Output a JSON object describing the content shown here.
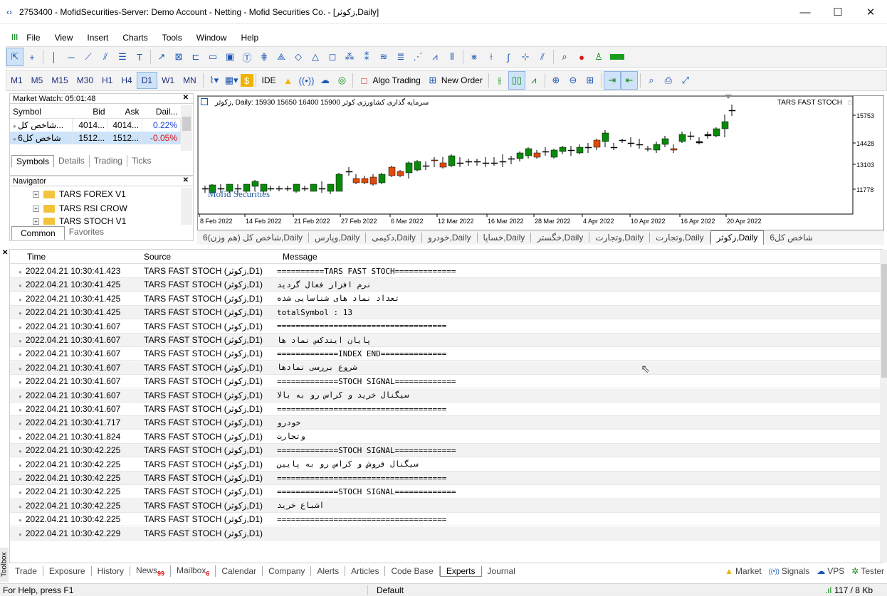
{
  "window": {
    "title": "2753400 - MofidSecurities-Server: Demo Account - Netting - Mofid Securities Co. - [زکوثر,Daily]",
    "minimize": "—",
    "maximize": "☐",
    "close": "✕"
  },
  "menu": [
    "File",
    "View",
    "Insert",
    "Charts",
    "Tools",
    "Window",
    "Help"
  ],
  "timeframes": [
    "M1",
    "M5",
    "M15",
    "M30",
    "H1",
    "H4",
    "D1",
    "W1",
    "MN"
  ],
  "toolbar2": {
    "ide": "IDE",
    "algo": "Algo Trading",
    "new_order": "New Order"
  },
  "market_watch": {
    "title": "Market Watch: 05:01:48",
    "columns": [
      "Symbol",
      "Bid",
      "Ask",
      "Dail..."
    ],
    "rows": [
      {
        "symbol": "شاخص کل...",
        "bid": "4014...",
        "ask": "4014...",
        "daily": "0.22%",
        "color": "#1a3fd6"
      },
      {
        "symbol": "شاخص کل6",
        "bid": "1512...",
        "ask": "1512...",
        "daily": "-0.05%",
        "color": "#d11"
      }
    ],
    "tabs": [
      "Symbols",
      "Details",
      "Trading",
      "Ticks"
    ]
  },
  "navigator": {
    "title": "Navigator",
    "items": [
      "TARS FOREX V1",
      "TARS RSI CROW",
      "TARS STOCH V1"
    ],
    "tabs": [
      "Common",
      "Favorites"
    ]
  },
  "chart": {
    "header": "زکوثر, Daily:  15930 15650 16400 15900  سرمایه گذاری کشاورزی کوثر",
    "indicator": "TARS FAST STOCH",
    "watermark": "Mofid Securities",
    "price_labels": [
      "15753",
      "14428",
      "13103",
      "11778"
    ],
    "date_labels": [
      "8 Feb 2022",
      "14 Feb 2022",
      "21 Feb 2022",
      "27 Feb 2022",
      "6 Mar 2022",
      "12 Mar 2022",
      "16 Mar 2022",
      "28 Mar 2022",
      "4 Apr 2022",
      "10 Apr 2022",
      "16 Apr 2022",
      "20 Apr 2022"
    ],
    "up_color": "#0a8a0a",
    "down_color": "#e24a0a"
  },
  "chart_tabs": [
    "شاخص کل (هم وزن)6,Daily",
    "وپارس,Daily",
    "دکیمی,Daily",
    "خودرو,Daily",
    "خساپا,Daily",
    "خگستر,Daily",
    "وتجارت,Daily",
    "وتجارت,Daily",
    "زکوثر,Daily",
    "شاخص کل6"
  ],
  "log": {
    "columns": [
      "Time",
      "Source",
      "Message"
    ],
    "rows": [
      {
        "time": "2022.04.21 10:30:41.423",
        "source": "TARS FAST STOCH (زکوثر,D1)",
        "msg": "==========TARS FAST STOCH============="
      },
      {
        "time": "2022.04.21 10:30:41.425",
        "source": "TARS FAST STOCH (زکوثر,D1)",
        "msg": "نرم افزار فعال گردید"
      },
      {
        "time": "2022.04.21 10:30:41.425",
        "source": "TARS FAST STOCH (زکوثر,D1)",
        "msg": "تعداد نماد های شناسایی شده"
      },
      {
        "time": "2022.04.21 10:30:41.425",
        "source": "TARS FAST STOCH (زکوثر,D1)",
        "msg": "totalSymbol : 13"
      },
      {
        "time": "2022.04.21 10:30:41.607",
        "source": "TARS FAST STOCH (زکوثر,D1)",
        "msg": "===================================="
      },
      {
        "time": "2022.04.21 10:30:41.607",
        "source": "TARS FAST STOCH (زکوثر,D1)",
        "msg": "پایان ایندکس نماد ها"
      },
      {
        "time": "2022.04.21 10:30:41.607",
        "source": "TARS FAST STOCH (زکوثر,D1)",
        "msg": "=============INDEX END=============="
      },
      {
        "time": "2022.04.21 10:30:41.607",
        "source": "TARS FAST STOCH (زکوثر,D1)",
        "msg": "شروع بررسی نمادها"
      },
      {
        "time": "2022.04.21 10:30:41.607",
        "source": "TARS FAST STOCH (زکوثر,D1)",
        "msg": "=============STOCH SIGNAL============="
      },
      {
        "time": "2022.04.21 10:30:41.607",
        "source": "TARS FAST STOCH (زکوثر,D1)",
        "msg": "سیگنال خرید و کراس رو به بالا"
      },
      {
        "time": "2022.04.21 10:30:41.607",
        "source": "TARS FAST STOCH (زکوثر,D1)",
        "msg": "===================================="
      },
      {
        "time": "2022.04.21 10:30:41.717",
        "source": "TARS FAST STOCH (زکوثر,D1)",
        "msg": "خودرو"
      },
      {
        "time": "2022.04.21 10:30:41.824",
        "source": "TARS FAST STOCH (زکوثر,D1)",
        "msg": "وتجارت"
      },
      {
        "time": "2022.04.21 10:30:42.225",
        "source": "TARS FAST STOCH (زکوثر,D1)",
        "msg": "=============STOCH SIGNAL============="
      },
      {
        "time": "2022.04.21 10:30:42.225",
        "source": "TARS FAST STOCH (زکوثر,D1)",
        "msg": "سیگنال فروش و کراس رو به پایین"
      },
      {
        "time": "2022.04.21 10:30:42.225",
        "source": "TARS FAST STOCH (زکوثر,D1)",
        "msg": "===================================="
      },
      {
        "time": "2022.04.21 10:30:42.225",
        "source": "TARS FAST STOCH (زکوثر,D1)",
        "msg": "=============STOCH SIGNAL============="
      },
      {
        "time": "2022.04.21 10:30:42.225",
        "source": "TARS FAST STOCH (زکوثر,D1)",
        "msg": "اشباع خرید"
      },
      {
        "time": "2022.04.21 10:30:42.225",
        "source": "TARS FAST STOCH (زکوثر,D1)",
        "msg": "===================================="
      },
      {
        "time": "2022.04.21 10:30:42.229",
        "source": "TARS FAST STOCH (زکوثر,D1)",
        "msg": ""
      }
    ]
  },
  "toolbox_label": "Toolbox",
  "bottom_tabs": [
    {
      "label": "Trade"
    },
    {
      "label": "Exposure"
    },
    {
      "label": "History"
    },
    {
      "label": "News",
      "badge": "99"
    },
    {
      "label": "Mailbox",
      "badge": "6"
    },
    {
      "label": "Calendar"
    },
    {
      "label": "Company"
    },
    {
      "label": "Alerts"
    },
    {
      "label": "Articles"
    },
    {
      "label": "Code Base"
    },
    {
      "label": "Experts",
      "active": true
    },
    {
      "label": "Journal"
    }
  ],
  "bottom_right": {
    "market": "Market",
    "signals": "Signals",
    "vps": "VPS",
    "tester": "Tester"
  },
  "status": {
    "help": "For Help, press F1",
    "profile": "Default",
    "conn": "117 / 8 Kb"
  }
}
